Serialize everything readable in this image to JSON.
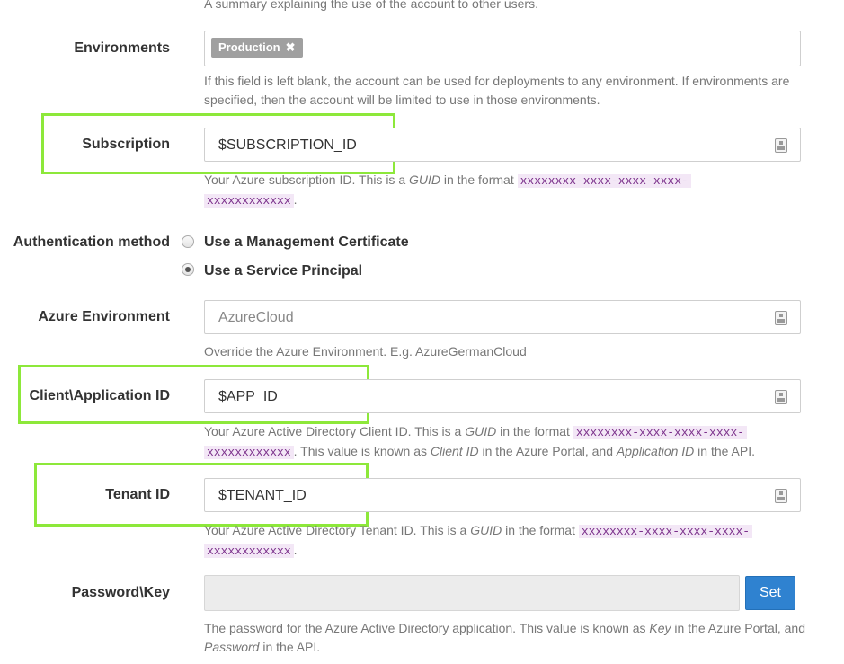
{
  "top_help": "A summary explaining the use of the account to other users.",
  "environments": {
    "label": "Environments",
    "tag": "Production",
    "tag_remove": "✖",
    "help": "If this field is left blank, the account can be used for deployments to any environment. If environments are specified, then the account will be limited to use in those environments."
  },
  "subscription": {
    "label": "Subscription",
    "value": "$SUBSCRIPTION_ID",
    "help_pre": "Your Azure subscription ID. This is a ",
    "help_guid": "GUID",
    "help_mid": " in the format ",
    "help_code1": "xxxxxxxx-xxxx-xxxx-xxxx-",
    "help_code2": "xxxxxxxxxxxx",
    "help_end": "."
  },
  "auth": {
    "label": "Authentication method",
    "options": [
      "Use a Management Certificate",
      "Use a Service Principal"
    ],
    "selected": "Use a Service Principal"
  },
  "azure_env": {
    "label": "Azure Environment",
    "placeholder": "AzureCloud",
    "help": "Override the Azure Environment. E.g. AzureGermanCloud"
  },
  "client": {
    "label": "Client\\Application ID",
    "value": "$APP_ID",
    "help_pre": "Your Azure Active Directory Client ID. This is a ",
    "help_guid": "GUID",
    "help_mid": " in the format ",
    "help_code1": "xxxxxxxx-xxxx-xxxx-xxxx-",
    "help_code2": "xxxxxxxxxxxx",
    "help_after": ". This value is known as ",
    "help_em1": "Client ID",
    "help_mid2": " in the Azure Portal, and ",
    "help_em2": "Application ID",
    "help_end": " in the API."
  },
  "tenant": {
    "label": "Tenant ID",
    "value": "$TENANT_ID",
    "help_pre": "Your Azure Active Directory Tenant ID. This is a ",
    "help_guid": "GUID",
    "help_mid": " in the format ",
    "help_code1": "xxxxxxxx-xxxx-xxxx-xxxx-",
    "help_code2": "xxxxxxxxxxxx",
    "help_end": "."
  },
  "password": {
    "label": "Password\\Key",
    "button": "Set",
    "help_pre": "The password for the Azure Active Directory application. This value is known as ",
    "help_em1": "Key",
    "help_mid": " in the Azure Portal, and ",
    "help_em2": "Password",
    "help_end": " in the API."
  },
  "colors": {
    "highlight": "#8de83a",
    "button": "#2f82d0",
    "code_bg": "#f3e7f6",
    "code_fg": "#7a2f8a"
  },
  "icons": {
    "field_icon": "keyboard-icon"
  }
}
